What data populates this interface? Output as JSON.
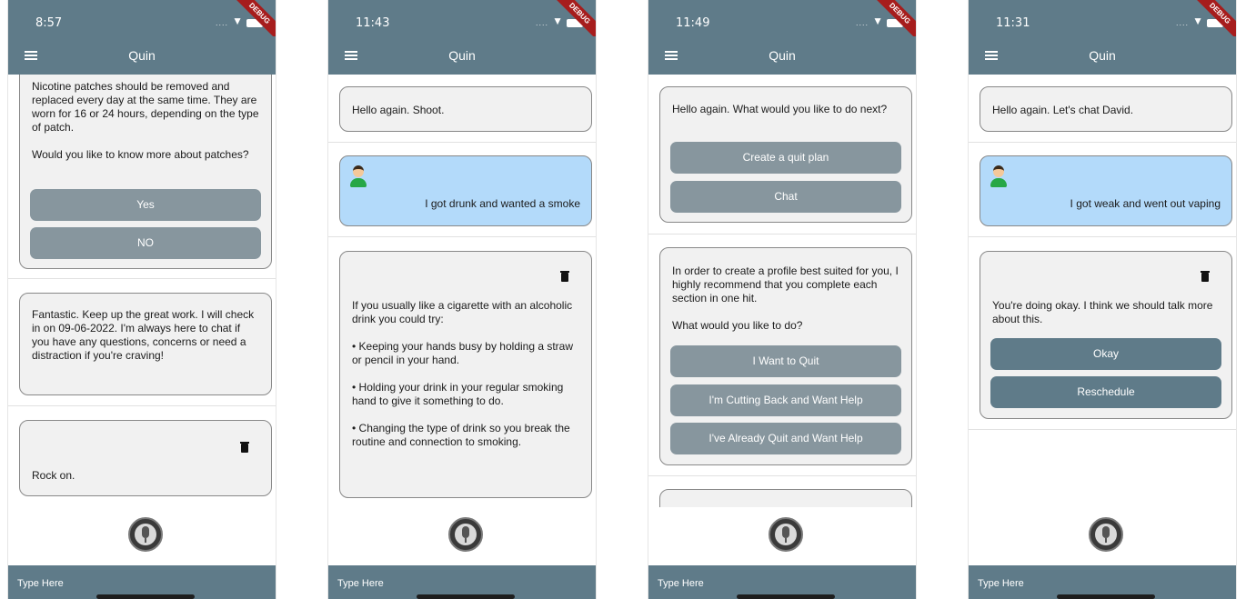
{
  "app_title": "Quin",
  "input_placeholder": "Type Here",
  "screens": [
    {
      "time": "8:57",
      "messages": [
        "Nicotine patches should be removed and replaced every day at the same time. They are worn for 16 or 24 hours, depending on the type of patch.\n\nWould you like to know more about patches?",
        "Fantastic. Keep up the great work. I will check in on 09-06-2022. I'm always here to chat if you have any questions, concerns or need a distraction if you're craving!",
        "Rock on."
      ],
      "buttons": [
        "Yes",
        "NO"
      ]
    },
    {
      "time": "11:43",
      "messages": [
        "Hello again. Shoot.",
        "I got drunk and wanted a smoke",
        "If you usually like a cigarette with an alcoholic drink you could try:\n\n• Keeping your hands busy by holding a straw or pencil in your hand.\n\n• Holding your drink in your regular smoking hand to give it something to do.\n\n• Changing the type of drink so you break the routine and connection to smoking."
      ]
    },
    {
      "time": "11:49",
      "messages": [
        "Hello again. What would you like to do next?",
        "In order to create a profile best suited for you, I highly recommend that you complete each section in one hit.\n\nWhat would you like to do?"
      ],
      "buttons": [
        "Create a quit plan",
        "Chat",
        "I Want to Quit",
        "I'm Cutting Back and Want Help",
        "I've Already Quit and Want Help"
      ]
    },
    {
      "time": "11:31",
      "messages": [
        "Hello again. Let's chat David.",
        "I got weak and went out vaping",
        "You're doing okay. I think we should talk more about this."
      ],
      "buttons": [
        "Okay",
        "Reschedule"
      ]
    }
  ]
}
